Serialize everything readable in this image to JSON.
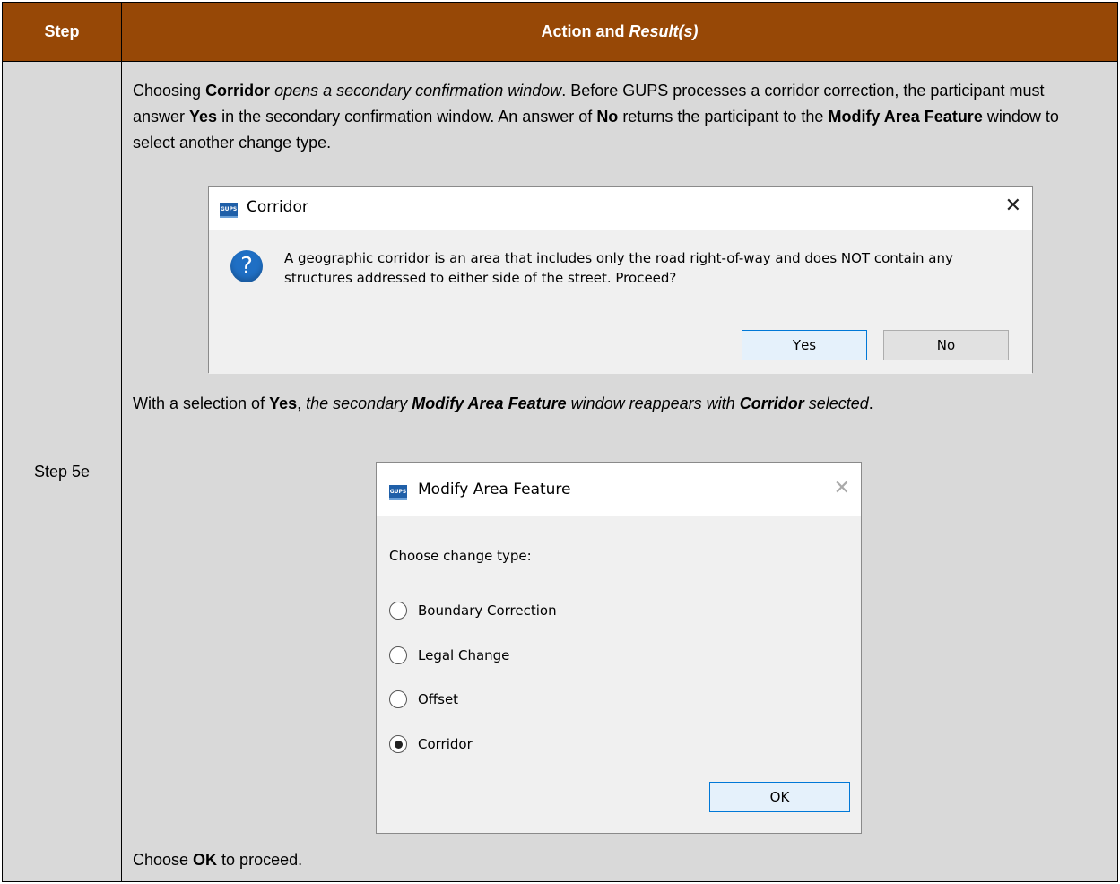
{
  "header": {
    "step": "Step",
    "action_prefix": "Action and ",
    "action_italic": "Result(s)"
  },
  "row": {
    "step_label": "Step 5e"
  },
  "para1": {
    "t1": "Choosing ",
    "b1": "Corridor",
    "i1": " opens a secondary confirmation window",
    "t2": ". Before GUPS processes a corridor correction, the participant must answer ",
    "b2": "Yes",
    "t3": " in the secondary confirmation window. An answer of ",
    "b3": "No",
    "t4": " returns the participant to the ",
    "b4": "Modify Area Feature",
    "t5": " window to select another change type."
  },
  "dialog_corridor": {
    "icon_text": "GUPS",
    "title": "Corridor",
    "close": "✕",
    "question_icon": "?",
    "message": "A geographic corridor is an area that includes only the road right-of-way and does NOT contain any structures addressed to either side of the street. Proceed?",
    "yes_mnemonic": "Y",
    "yes_rest": "es",
    "no_mnemonic": "N",
    "no_rest": "o"
  },
  "para2": {
    "t1": "With a selection of ",
    "b1": "Yes",
    "t2": ", ",
    "i1": "the secondary ",
    "bi1": "Modify Area Feature",
    "i2": " window reappears with ",
    "bi2": "Corridor",
    "i3": " selected",
    "t3": "."
  },
  "dialog_modify": {
    "icon_text": "GUPS",
    "title": "Modify Area Feature",
    "close": "✕",
    "prompt": "Choose change type:",
    "options": [
      {
        "label": "Boundary Correction",
        "selected": false
      },
      {
        "label": "Legal Change",
        "selected": false
      },
      {
        "label": "Offset",
        "selected": false
      },
      {
        "label": "Corridor",
        "selected": true
      }
    ],
    "ok": "OK"
  },
  "para3": {
    "t1": "Choose ",
    "b1": "OK",
    "t2": " to proceed."
  },
  "colors": {
    "header_bg": "#974806",
    "cell_bg": "#d9d9d9",
    "accent": "#0078d7"
  }
}
